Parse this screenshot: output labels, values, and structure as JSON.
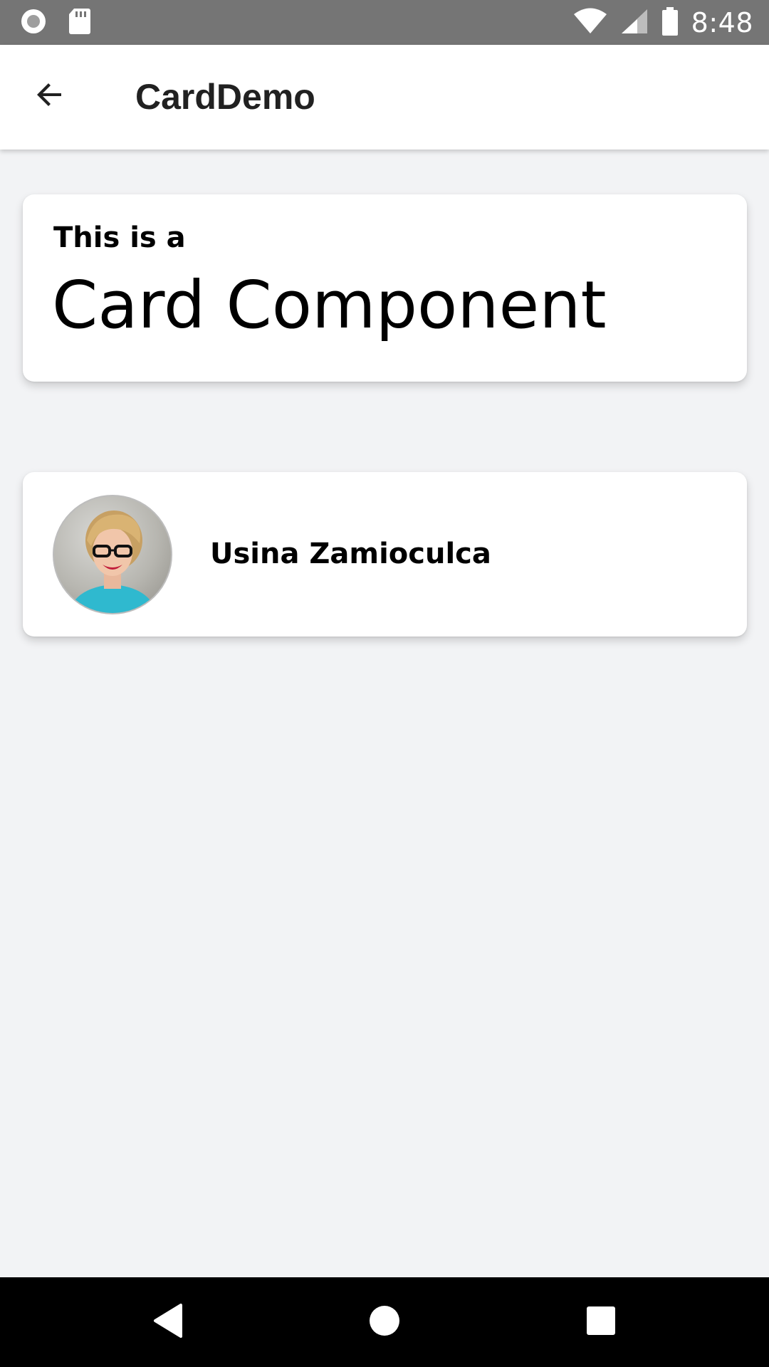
{
  "status_bar": {
    "time": "8:48",
    "left_icons": [
      "record-icon",
      "sd-card-icon"
    ],
    "right_icons": [
      "wifi-icon",
      "cell-signal-icon",
      "battery-icon"
    ],
    "background_color": "#757575"
  },
  "app_bar": {
    "title": "CardDemo",
    "back_icon": "arrow-back-icon"
  },
  "cards": {
    "intro": {
      "subtitle": "This is a",
      "title": "Card Component"
    },
    "profile": {
      "name": "Usina Zamioculca",
      "avatar": "avatar-photo"
    }
  },
  "nav_bar": {
    "icons": [
      "back-triangle-icon",
      "home-circle-icon",
      "recents-square-icon"
    ]
  },
  "colors": {
    "background": "#f2f3f5",
    "card": "#ffffff",
    "text": "#000000"
  }
}
